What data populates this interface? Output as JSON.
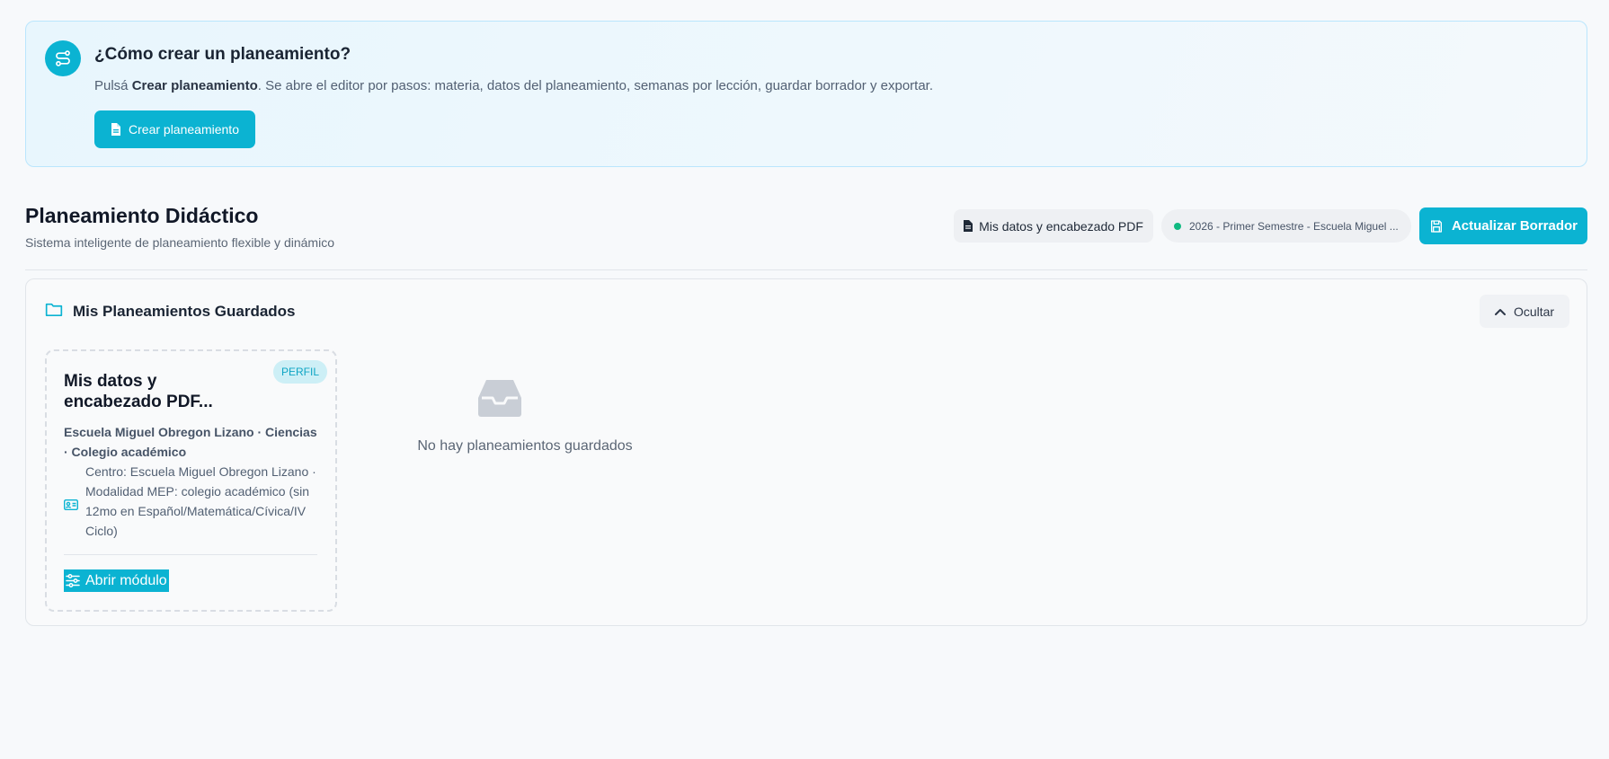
{
  "help": {
    "title": "¿Cómo crear un planeamiento?",
    "text_prefix": "Pulsá ",
    "text_bold": "Crear planeamiento",
    "text_suffix": ". Se abre el editor por pasos: materia, datos del planeamiento, semanas por lección, guardar borrador y exportar.",
    "button_label": "Crear planeamiento",
    "icon": "route-icon"
  },
  "header": {
    "title": "Planeamiento Didáctico",
    "subtitle": "Sistema inteligente de planeamiento flexible y dinámico",
    "profile_button": "Mis datos y encabezado PDF",
    "period_label": "2026 - Primer Semestre - Escuela Miguel ...",
    "update_button": "Actualizar Borrador"
  },
  "saved": {
    "title": "Mis Planeamientos Guardados",
    "hide_button": "Ocultar",
    "card": {
      "badge": "PERFIL",
      "title": "Mis datos y encabezado PDF...",
      "subtitle": "Escuela Miguel Obregon Lizano · Ciencias · Colegio académico",
      "description": "Centro: Escuela Miguel Obregon Lizano · Modalidad MEP: colegio académico (sin 12mo en Español/Matemática/Cívica/IV Ciclo)",
      "link": "Abrir módulo"
    },
    "empty_text": "No hay planeamientos guardados"
  },
  "colors": {
    "accent": "#0bb3d2",
    "status_dot": "#10b981",
    "banner_border": "#bae6fd"
  }
}
